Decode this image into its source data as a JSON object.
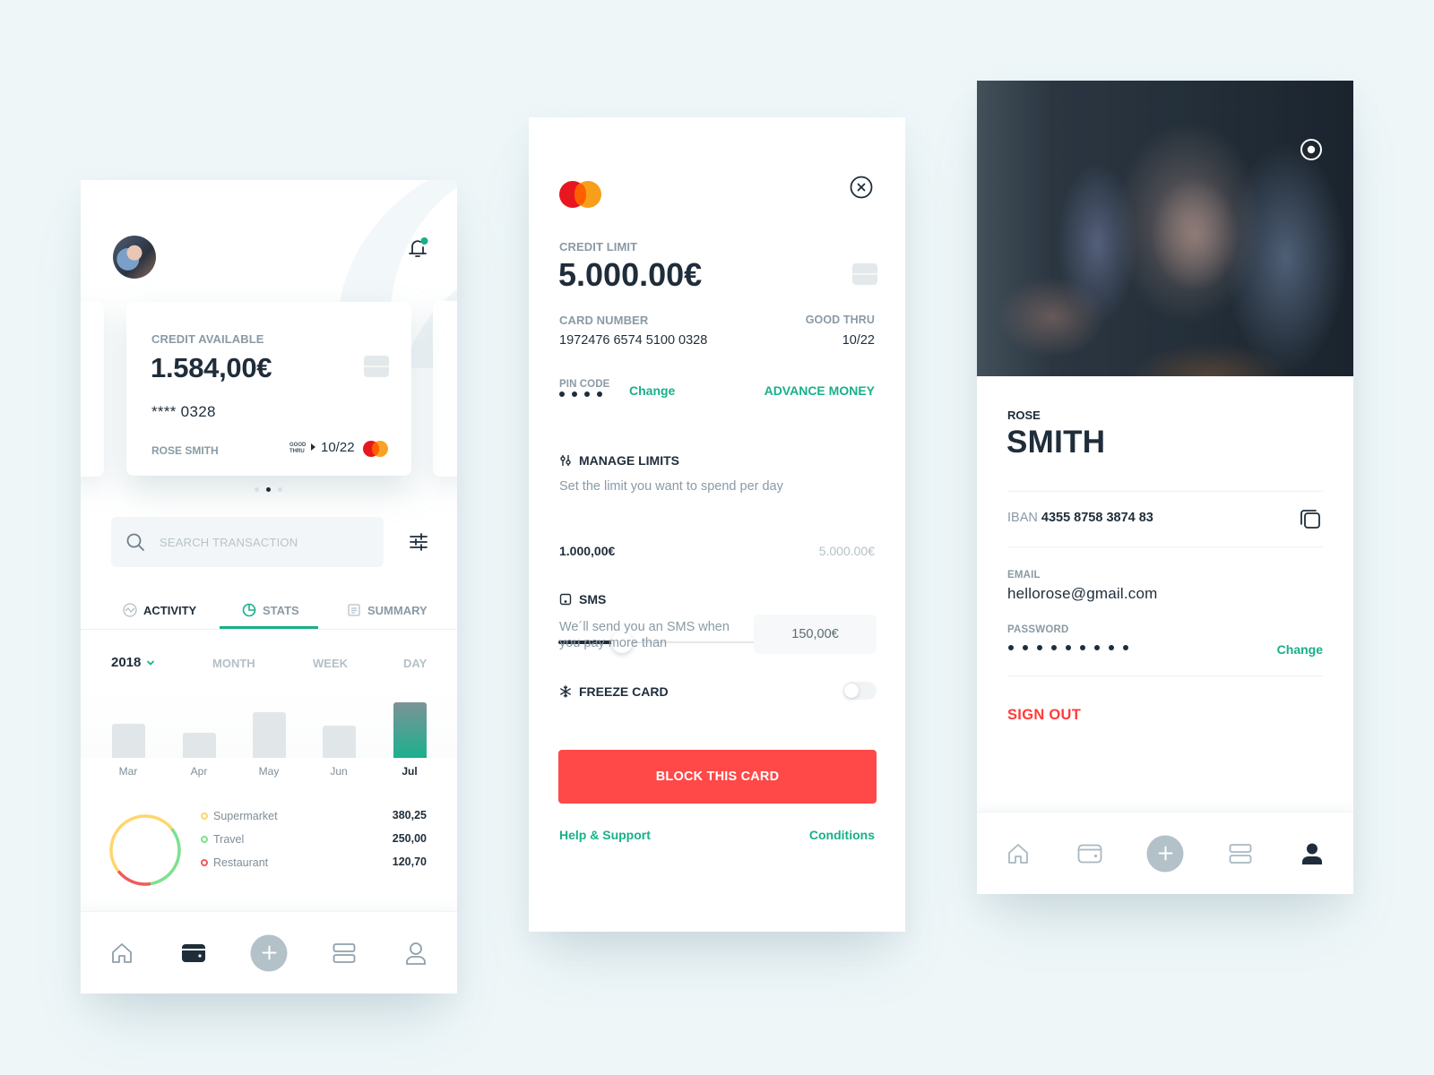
{
  "colors": {
    "background": "#eef6f8",
    "accent_green": "#18b08a",
    "danger_red": "#ff4848",
    "text_dark": "#1f2d3a",
    "text_muted": "#8a9aa5",
    "mastercard_red": "#e8161f",
    "mastercard_orange": "#f79f1a"
  },
  "home_screen": {
    "header": {
      "avatar_icon": "user-avatar",
      "notification_icon": "bell-icon",
      "has_unread_notification": true
    },
    "card": {
      "label": "CREDIT AVAILABLE",
      "amount": "1.584,00€",
      "masked_number": "**** 0328",
      "holder": "ROSE SMITH",
      "good_thru_line1": "GOOD",
      "good_thru_line2": "THRU",
      "expiry": "10/22",
      "brand_icon": "mastercard-logo",
      "chip_icon": "card-chip-icon"
    },
    "carousel": {
      "page_count": 3,
      "active_index": 1
    },
    "search": {
      "placeholder": "SEARCH TRANSACTION",
      "value": "",
      "icon": "search-icon",
      "filter_icon": "sliders-icon"
    },
    "tabs": [
      {
        "label": "ACTIVITY",
        "icon": "activity-icon",
        "active": false
      },
      {
        "label": "STATS",
        "icon": "pie-chart-icon",
        "active": true
      },
      {
        "label": "SUMMARY",
        "icon": "document-icon",
        "active": false
      }
    ],
    "period": {
      "year": "2018",
      "options": [
        "MONTH",
        "WEEK",
        "DAY"
      ]
    },
    "nav": [
      {
        "icon": "home-icon",
        "active": false
      },
      {
        "icon": "wallet-icon",
        "active": true
      },
      {
        "icon": "plus-icon",
        "active": false
      },
      {
        "icon": "list-icon",
        "active": false
      },
      {
        "icon": "user-icon",
        "active": false
      }
    ]
  },
  "chart_data": [
    {
      "type": "bar",
      "title": "",
      "categories": [
        "Mar",
        "Apr",
        "May",
        "Jun",
        "Jul"
      ],
      "values": [
        37,
        28,
        50,
        35,
        61
      ],
      "highlighted": "Jul",
      "xlabel": "",
      "ylabel": "",
      "ylim": [
        0,
        61
      ],
      "grid": false,
      "note": "relative monthly spending; no y-axis shown"
    },
    {
      "type": "pie",
      "style": "donut",
      "labels": [
        "Supermarket",
        "Travel",
        "Restaurant"
      ],
      "values": [
        380.25,
        250.0,
        120.7
      ],
      "display_values": [
        "380,25",
        "250,00",
        "120,70"
      ],
      "colors": [
        "#ffd56b",
        "#7ee08f",
        "#ef5b5b"
      ],
      "legend": "right"
    }
  ],
  "card_details": {
    "brand_icon": "mastercard-logo",
    "close_icon": "close-circle-icon",
    "credit_limit_label": "CREDIT LIMIT",
    "credit_limit": "5.000.00€",
    "card_number_label": "CARD NUMBER",
    "card_number": "1972476 6574 5100 0328",
    "good_thru_label": "GOOD THRU",
    "good_thru": "10/22",
    "pin_label": "PIN CODE",
    "pin_digits": 4,
    "pin_change": "Change",
    "advance_money": "ADVANCE MONEY",
    "manage_limits": {
      "title": "MANAGE LIMITS",
      "icon": "sliders-vertical-icon",
      "description": "Set the limit you want to spend per day",
      "current": "1.000,00€",
      "max": "5.000.00€",
      "fraction": 0.2
    },
    "sms": {
      "title": "SMS",
      "icon": "phone-icon",
      "description_line1": "We´ll send you an SMS when",
      "description_line2": "you pay more than",
      "threshold": "150,00€"
    },
    "freeze": {
      "title": "FREEZE CARD",
      "icon": "snowflake-icon",
      "enabled": false
    },
    "block_button": "BLOCK THIS CARD",
    "help_link": "Help & Support",
    "conditions_link": "Conditions"
  },
  "profile": {
    "camera_icon": "camera-icon",
    "first_name": "ROSE",
    "last_name": "SMITH",
    "iban_label": "IBAN",
    "iban": "4355 8758 3874 83",
    "copy_icon": "copy-icon",
    "email_label": "EMAIL",
    "email": "hellorose@gmail.com",
    "password_label": "PASSWORD",
    "password_length": 9,
    "password_change": "Change",
    "sign_out": "SIGN OUT",
    "nav": [
      {
        "icon": "home-icon",
        "active": false
      },
      {
        "icon": "wallet-icon",
        "active": false
      },
      {
        "icon": "plus-icon",
        "active": false
      },
      {
        "icon": "list-icon",
        "active": false
      },
      {
        "icon": "user-icon",
        "active": true
      }
    ]
  }
}
